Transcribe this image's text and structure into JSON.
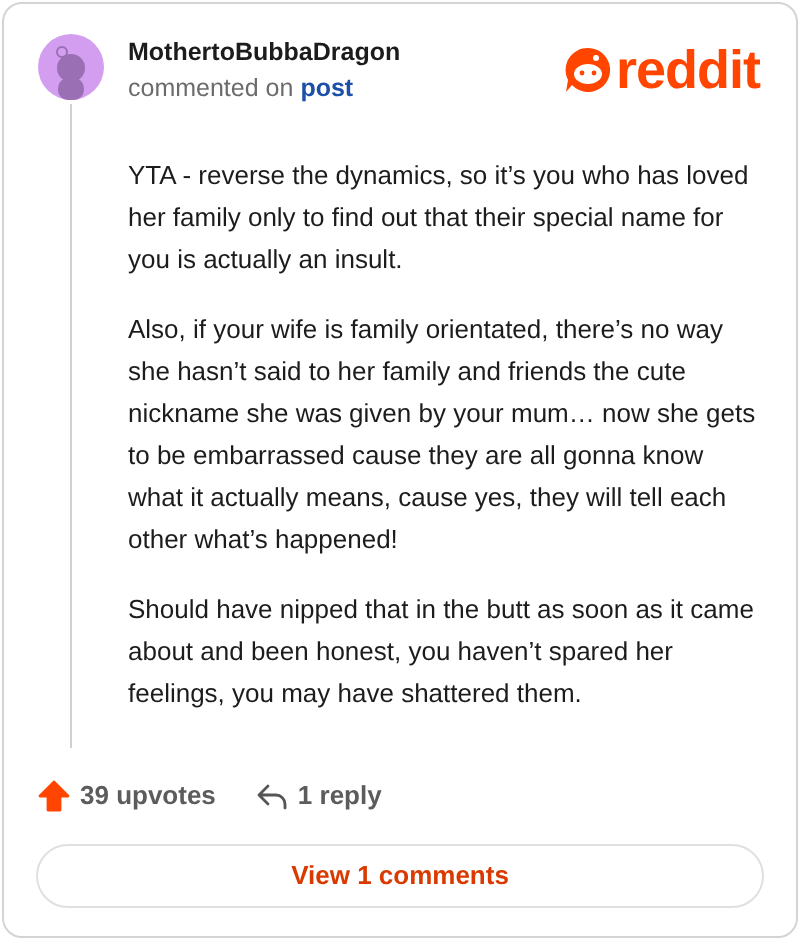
{
  "comment": {
    "author": "MothertoBubbaDragon",
    "action": "commented",
    "preposition": "on",
    "link": "post"
  },
  "brand": {
    "wordmark": "reddit"
  },
  "paragraphs": [
    "YTA - reverse the dynamics, so it’s you who has loved her family only to find out that their special name for you is actually an insult.",
    "Also, if your wife is family orientated, there’s no way she hasn’t said to her family and friends the cute nickname she was given by your mum… now she gets to be embarrassed cause they are all gonna know what it actually means, cause yes, they will tell each other what’s happened!",
    "Should have nipped that in the butt as soon as it came about and been honest, you haven’t spared her feelings, you may have shattered them."
  ],
  "footer": {
    "upvotes": "39 upvotes",
    "upvoted": true,
    "replies": "1 reply"
  },
  "view_button": "View 1 comments"
}
